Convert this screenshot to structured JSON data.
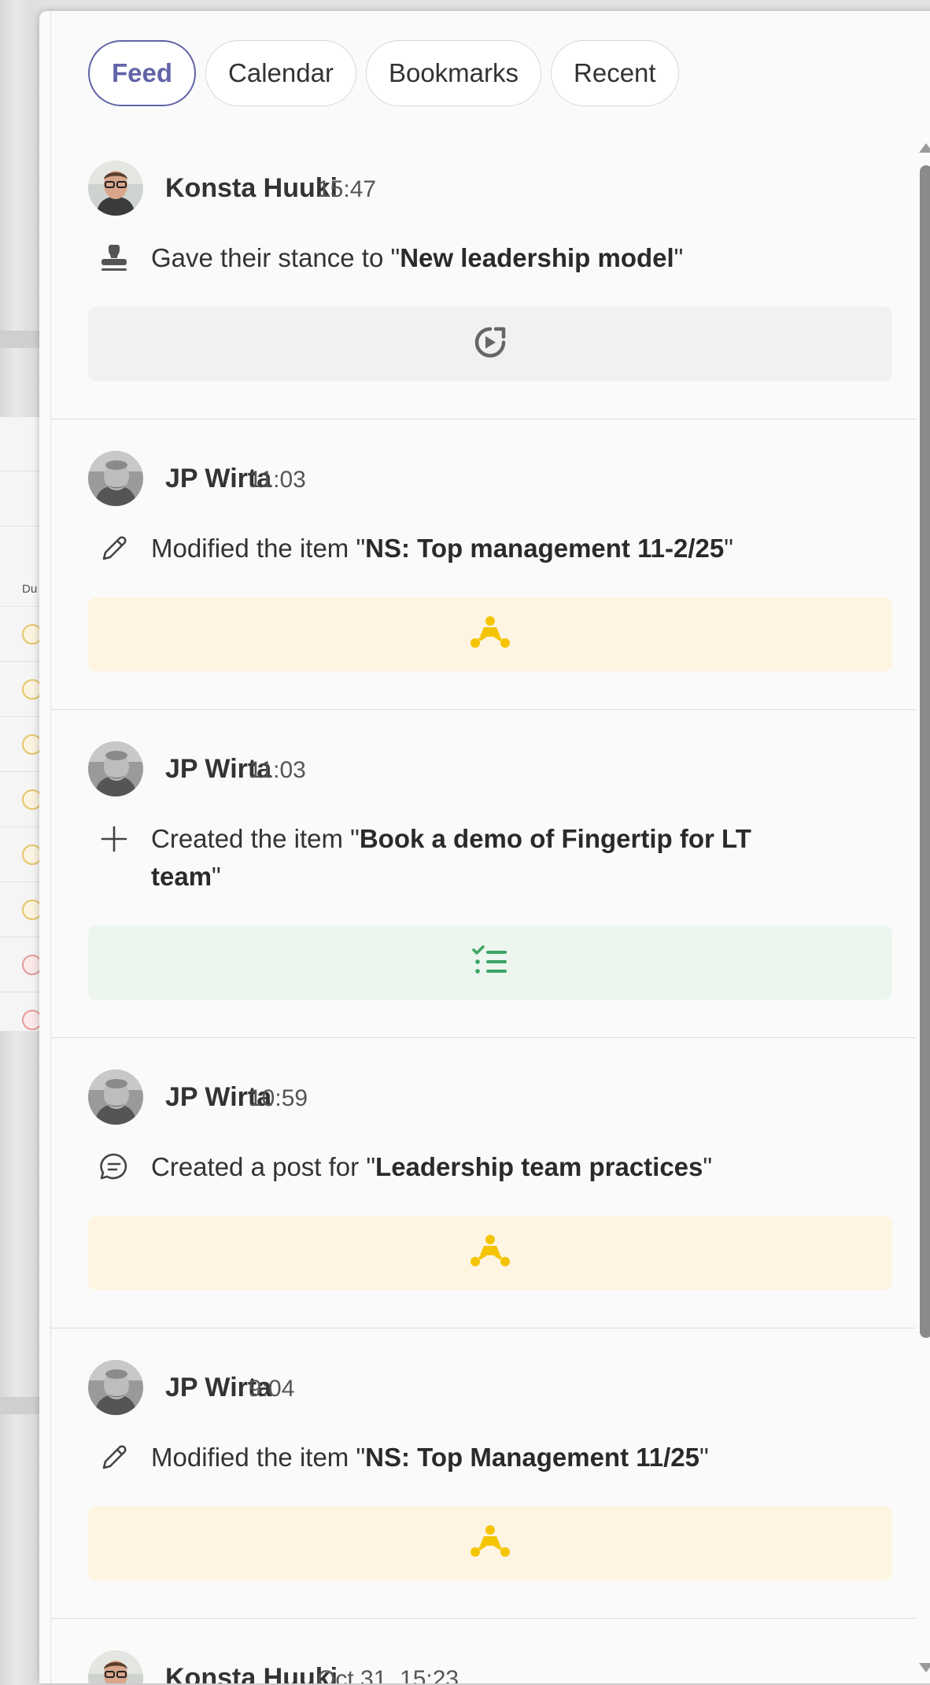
{
  "background": {
    "column_label": "Du"
  },
  "tabs": [
    {
      "label": "Feed",
      "active": true
    },
    {
      "label": "Calendar",
      "active": false
    },
    {
      "label": "Bookmarks",
      "active": false
    },
    {
      "label": "Recent",
      "active": false
    }
  ],
  "feed": [
    {
      "author": "Konsta Huuki",
      "time": "15:47",
      "action_icon": "stamp-icon",
      "action_prefix": "Gave their stance to \"",
      "target": "New leadership model",
      "action_suffix": "\"",
      "card_icon": "rotate-icon",
      "card_color": "#f1f1f1",
      "icon_color": "#666666"
    },
    {
      "author": "JP Wirta",
      "time": "11:03",
      "action_icon": "pencil-icon",
      "action_prefix": "Modified the item \"",
      "target": "NS: Top management 11-2/25",
      "action_suffix": "\"",
      "card_icon": "hierarchy-icon",
      "card_color": "#fdf5e2",
      "icon_color": "#f5c400"
    },
    {
      "author": "JP Wirta",
      "time": "11:03",
      "action_icon": "plus-icon",
      "action_prefix": "Created the item \"",
      "target": "Book a demo of Fingertip for LT team",
      "action_suffix": "\"",
      "card_icon": "checklist-icon",
      "card_color": "#ecf6ee",
      "icon_color": "#3aa564"
    },
    {
      "author": "JP Wirta",
      "time": "10:59",
      "action_icon": "chat-icon",
      "action_prefix": "Created a post for \"",
      "target": "Leadership team practices",
      "action_suffix": "\"",
      "card_icon": "hierarchy-icon",
      "card_color": "#fdf5e2",
      "icon_color": "#f5c400"
    },
    {
      "author": "JP Wirta",
      "time": "9:04",
      "action_icon": "pencil-icon",
      "action_prefix": "Modified the item \"",
      "target": "NS: Top Management 11/25",
      "action_suffix": "\"",
      "card_icon": "hierarchy-icon",
      "card_color": "#fdf5e2",
      "icon_color": "#f5c400"
    },
    {
      "author": "Konsta Huuki",
      "time": "Oct 31, 15:23"
    }
  ],
  "colors": {
    "accent": "#6264a7"
  }
}
